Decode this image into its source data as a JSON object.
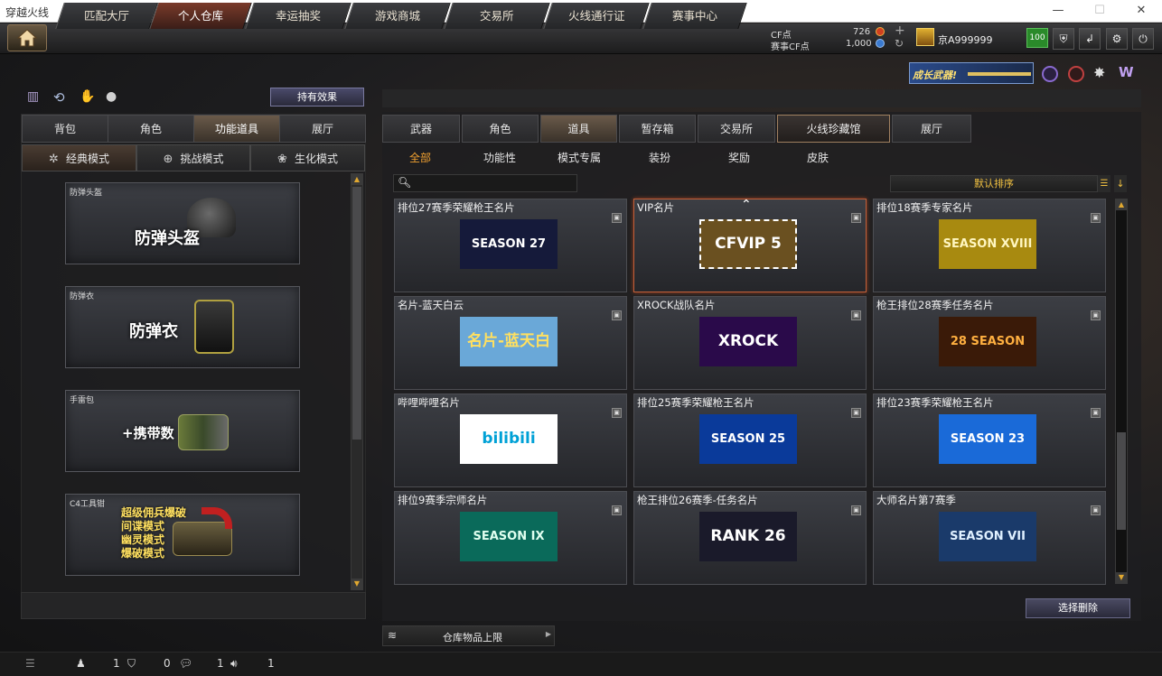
{
  "window": {
    "title": "穿越火线",
    "minimize": "—",
    "maximize": "☐",
    "close": "✕"
  },
  "nav": {
    "tabs": [
      {
        "label": "匹配大厅",
        "active": false
      },
      {
        "label": "个人仓库",
        "active": true
      },
      {
        "label": "幸运抽奖",
        "active": false
      },
      {
        "label": "游戏商城",
        "active": false
      },
      {
        "label": "交易所",
        "active": false
      },
      {
        "label": "火线通行证",
        "active": false
      },
      {
        "label": "赛事中心",
        "active": false
      }
    ],
    "currency": {
      "cf_label": "CF点",
      "cf_value": "726",
      "event_label": "赛事CF点",
      "event_value": "1,000"
    },
    "user": {
      "name": "京A999999",
      "level": "100"
    },
    "banner_text": "成长武器!"
  },
  "left": {
    "effect_button": "持有效果",
    "tabs": [
      {
        "label": "背包",
        "active": false
      },
      {
        "label": "角色",
        "active": false
      },
      {
        "label": "功能道具",
        "active": true
      },
      {
        "label": "展厅",
        "active": false
      }
    ],
    "modes": [
      {
        "label": "经典模式",
        "icon": "✲",
        "active": true
      },
      {
        "label": "挑战模式",
        "icon": "⊕",
        "active": false
      },
      {
        "label": "生化模式",
        "icon": "❀",
        "active": false
      }
    ],
    "items": [
      {
        "caption": "防弹头盔",
        "title": "防弹头盔"
      },
      {
        "caption": "防弹衣",
        "title": "防弹衣"
      },
      {
        "caption": "手雷包",
        "title": "+携带数"
      },
      {
        "caption": "C4工具钳",
        "lines": [
          "超级佣兵爆破",
          "间谍模式",
          "幽灵模式",
          "爆破模式"
        ]
      }
    ]
  },
  "right": {
    "tabs": [
      {
        "label": "武器",
        "style": "normal"
      },
      {
        "label": "角色",
        "style": "normal"
      },
      {
        "label": "道具",
        "style": "active"
      },
      {
        "label": "暂存箱",
        "style": "normal"
      },
      {
        "label": "交易所",
        "style": "normal"
      },
      {
        "label": "火线珍藏馆",
        "style": "special"
      },
      {
        "label": "展厅",
        "style": "normal"
      }
    ],
    "subtabs": [
      {
        "label": "全部",
        "active": true
      },
      {
        "label": "功能性",
        "active": false
      },
      {
        "label": "模式专属",
        "active": false
      },
      {
        "label": "装扮",
        "active": false
      },
      {
        "label": "奖励",
        "active": false
      },
      {
        "label": "皮肤",
        "active": false
      }
    ],
    "search_placeholder": "",
    "sort_label": "默认排序",
    "cards": [
      {
        "title": "排位27赛季荣耀枪王名片",
        "art": "SEASON 27",
        "bg": "#151a3a",
        "fg": "#ffffff"
      },
      {
        "title": "VIP名片",
        "art": "CFVIP 5",
        "bg": "#6a5020",
        "fg": "#ffffff",
        "selected": true
      },
      {
        "title": "排位18赛季专家名片",
        "art": "SEASON XVIII",
        "bg": "#a88a10",
        "fg": "#fff6c0"
      },
      {
        "title": "名片-蓝天白云",
        "art": "名片-蓝天白云",
        "bg": "#6aa8d8",
        "fg": "#ffe060"
      },
      {
        "title": "XROCK战队名片",
        "art": "XROCK",
        "bg": "#2a0a4a",
        "fg": "#ffffff"
      },
      {
        "title": "枪王排位28赛季任务名片",
        "art": "28 SEASON",
        "bg": "#3a1a08",
        "fg": "#ffb040"
      },
      {
        "title": "哔哩哔哩名片",
        "art": "bilibili",
        "bg": "#ffffff",
        "fg": "#00a1d6"
      },
      {
        "title": "排位25赛季荣耀枪王名片",
        "art": "SEASON 25",
        "bg": "#0a3a9a",
        "fg": "#ffffff"
      },
      {
        "title": "排位23赛季荣耀枪王名片",
        "art": "SEASON 23",
        "bg": "#1a6ad8",
        "fg": "#ffffff"
      },
      {
        "title": "排位9赛季宗师名片",
        "art": "SEASON IX",
        "bg": "#0a6a5a",
        "fg": "#e0fff0"
      },
      {
        "title": "枪王排位26赛季-任务名片",
        "art": "RANK 26",
        "bg": "#1a1a2a",
        "fg": "#ffffff"
      },
      {
        "title": "大师名片第7赛季",
        "art": "SEASON VII",
        "bg": "#1a3a6a",
        "fg": "#e0f0ff"
      }
    ],
    "delete_button": "选择删除",
    "capacity_label": "仓库物品上限"
  },
  "status": {
    "c1": "1",
    "c2": "0",
    "c3": "1",
    "c4": "1"
  }
}
